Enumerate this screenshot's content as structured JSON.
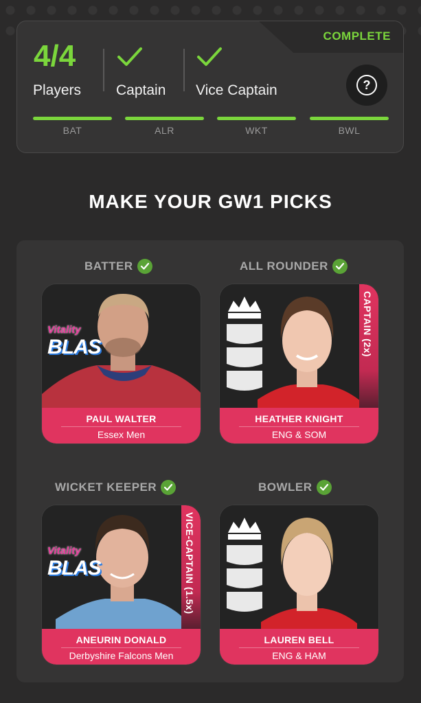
{
  "status": {
    "complete_label": "COMPLETE",
    "count": "4/4",
    "players_label": "Players",
    "captain_label": "Captain",
    "vice_captain_label": "Vice Captain",
    "positions": [
      "BAT",
      "ALR",
      "WKT",
      "BWL"
    ],
    "accent": "#7bd63c"
  },
  "heading": "MAKE YOUR GW1 PICKS",
  "picks": [
    {
      "position": "BATTER",
      "name": "PAUL WALTER",
      "team": "Essex Men",
      "role": "",
      "logo": "vitality-blast"
    },
    {
      "position": "ALL ROUNDER",
      "name": "HEATHER KNIGHT",
      "team": "ENG & SOM",
      "role": "CAPTAIN (2x)",
      "logo": "england-lions"
    },
    {
      "position": "WICKET KEEPER",
      "name": "ANEURIN DONALD",
      "team": "Derbyshire Falcons Men",
      "role": "VICE-CAPTAIN (1.5x)",
      "logo": "vitality-blast"
    },
    {
      "position": "BOWLER",
      "name": "LAUREN BELL",
      "team": "ENG & HAM",
      "role": "",
      "logo": "england-lions"
    }
  ],
  "logos": {
    "vitality_small": "Vitality",
    "blast": "BLAS"
  },
  "colors": {
    "pink": "#e0345f",
    "green_check": "#5aa336",
    "background": "#2b2a2a"
  }
}
